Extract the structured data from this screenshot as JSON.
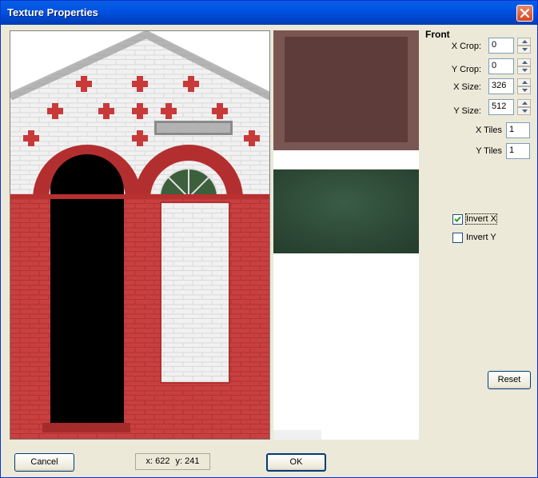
{
  "window": {
    "title": "Texture Properties"
  },
  "section": {
    "title": "Front"
  },
  "fields": {
    "x_crop": {
      "label": "X Crop:",
      "value": "0"
    },
    "y_crop": {
      "label": "Y Crop:",
      "value": "0"
    },
    "x_size": {
      "label": "X Size:",
      "value": "326"
    },
    "y_size": {
      "label": "Y Size:",
      "value": "512"
    },
    "x_tiles": {
      "label": "X Tiles",
      "value": "1"
    },
    "y_tiles": {
      "label": "Y Tiles",
      "value": "1"
    }
  },
  "checkboxes": {
    "invert_x": {
      "label": "Invert X",
      "checked": true
    },
    "invert_y": {
      "label": "Invert Y",
      "checked": false
    }
  },
  "buttons": {
    "reset": "Reset",
    "cancel": "Cancel",
    "ok": "OK"
  },
  "status": {
    "x": "x: 622",
    "y": "y: 241"
  },
  "icons": {
    "close": "close-icon",
    "spin_up": "arrow-up-icon",
    "spin_down": "arrow-down-icon",
    "check": "check-icon"
  },
  "colors": {
    "titlebar": "#0053e4",
    "face": "#ece9d8",
    "brick_red": "#c43a3a",
    "wall_white": "#f2f2f2",
    "preview_brown": "#6e4a48",
    "preview_green": "#2e4f3a"
  }
}
